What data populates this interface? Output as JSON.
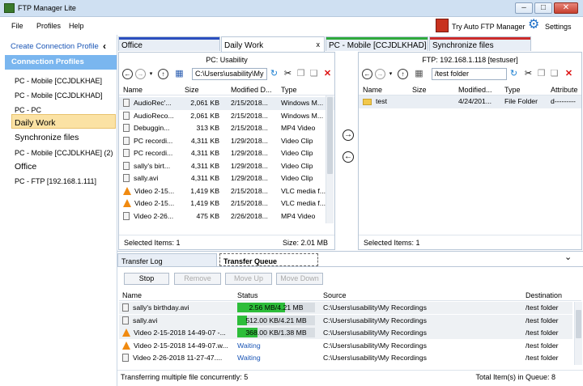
{
  "window": {
    "title": "FTP Manager Lite"
  },
  "menu": [
    "File",
    "Profiles",
    "Help"
  ],
  "header_actions": {
    "try_auto": "Try Auto FTP Manager",
    "settings": "Settings"
  },
  "sidebar": {
    "create_link": "Create Connection Profile",
    "header": "Connection Profiles",
    "items": [
      "PC - Mobile [CCJDLKHAE]",
      "PC - Mobile [CCJDLKHAD]",
      "PC - PC",
      "Daily Work",
      "Synchronize files",
      "PC - Mobile [CCJDLKHAE] (2)",
      "Office",
      "PC - FTP [192.168.1.111]"
    ],
    "selected": "Daily Work"
  },
  "tabs": [
    {
      "label": "Office",
      "color": "#2b4fbf"
    },
    {
      "label": "Daily Work",
      "color": "",
      "close": "x"
    },
    {
      "label": "PC - Mobile [CCJDLKHAD]",
      "color": "#2faa3c"
    },
    {
      "label": "Synchronize files",
      "color": "#cc2b2b"
    }
  ],
  "local": {
    "title": "PC: Usability",
    "path": "C:\\Users\\usability\\My",
    "columns": [
      "Name",
      "Size",
      "Modified D...",
      "Type"
    ],
    "rows": [
      [
        "AudioRec'...",
        "2,061 KB",
        "2/15/2018...",
        "Windows M..."
      ],
      [
        "AudioReco...",
        "2,061 KB",
        "2/15/2018...",
        "Windows M..."
      ],
      [
        "Debuggin...",
        "313 KB",
        "2/15/2018...",
        "MP4 Video"
      ],
      [
        "PC recordi...",
        "4,311 KB",
        "1/29/2018...",
        "Video Clip"
      ],
      [
        "PC recordi...",
        "4,311 KB",
        "1/29/2018...",
        "Video Clip"
      ],
      [
        "sally's birt...",
        "4,311 KB",
        "1/29/2018...",
        "Video Clip"
      ],
      [
        "sally.avi",
        "4,311 KB",
        "1/29/2018...",
        "Video Clip"
      ],
      [
        "Video 2-15...",
        "1,419 KB",
        "2/15/2018...",
        "VLC media f..."
      ],
      [
        "Video 2-15...",
        "1,419 KB",
        "2/15/2018...",
        "VLC media f..."
      ],
      [
        "Video 2-26...",
        "475 KB",
        "2/26/2018...",
        "MP4 Video"
      ]
    ],
    "row_icons": [
      "file",
      "file",
      "file",
      "file",
      "file",
      "file",
      "file",
      "vlc",
      "vlc",
      "file"
    ],
    "selected_items": "Selected Items: 1",
    "size": "Size: 2.01 MB"
  },
  "remote": {
    "title": "FTP: 192.168.1.118 [testuser]",
    "path": "/test folder",
    "columns": [
      "Name",
      "Size",
      "Modified...",
      "Type",
      "Attribute"
    ],
    "rows": [
      [
        "test",
        "",
        "4/24/201...",
        "File Folder",
        "d---------"
      ]
    ],
    "selected_items": "Selected Items: 1"
  },
  "transfer": {
    "tabs": [
      "Transfer Log",
      "Transfer Queue"
    ],
    "buttons": [
      "Stop",
      "Remove",
      "Move Up",
      "Move Down"
    ],
    "columns": [
      "Name",
      "Status",
      "Source",
      "Destination"
    ],
    "rows": [
      {
        "name": "sally's birthday.avi",
        "status": "2.56 MB/4.21 MB",
        "progress": 0.61,
        "source": "C:\\Users\\usability\\My Recordings",
        "dest": "/test folder",
        "icon": "file"
      },
      {
        "name": "sally.avi",
        "status": "512.00 KB/4.21 MB",
        "progress": 0.12,
        "source": "C:\\Users\\usability\\My Recordings",
        "dest": "/test folder",
        "icon": "file"
      },
      {
        "name": "Video 2-15-2018 14-49-07 -...",
        "status": "368.00 KB/1.38 MB",
        "progress": 0.26,
        "source": "C:\\Users\\usability\\My Recordings",
        "dest": "/test folder",
        "icon": "vlc"
      },
      {
        "name": "Video 2-15-2018 14-49-07.w...",
        "status": "Waiting",
        "progress": null,
        "source": "C:\\Users\\usability\\My Recordings",
        "dest": "/test folder",
        "icon": "vlc"
      },
      {
        "name": "Video 2-26-2018 11-27-47....",
        "status": "Waiting",
        "progress": null,
        "source": "C:\\Users\\usability\\My Recordings",
        "dest": "/test folder",
        "icon": "file"
      }
    ],
    "footer_left": "Transferring multiple file concurrently: 5",
    "footer_right": "Total Item(s) in Queue: 8"
  }
}
